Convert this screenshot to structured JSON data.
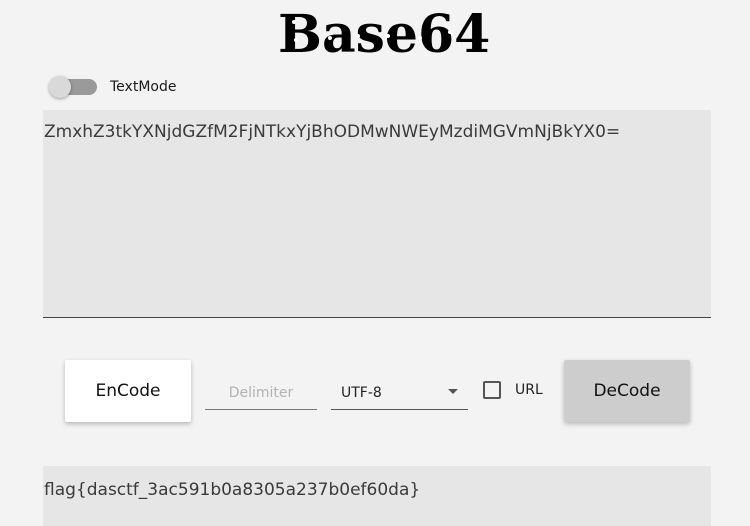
{
  "app": {
    "logo_text": "Base64"
  },
  "toggle": {
    "label": "TextMode",
    "checked": false
  },
  "input": {
    "value": "ZmxhZ3tkYXNjdGZfM2FjNTkxYjBhODMwNWEyMzdiMGVmNjBkYX0="
  },
  "toolbar": {
    "encode_label": "EnCode",
    "delimiter_placeholder": "Delimiter",
    "encoding_value": "UTF-8",
    "url_label": "URL",
    "url_checked": false,
    "decode_label": "DeCode"
  },
  "output": {
    "value": "flag{dasctf_3ac591b0a8305a237b0ef60da}"
  },
  "colors": {
    "background": "#f3f3f3",
    "field": "#e6e6e6",
    "decode_button": "#cdcdcd",
    "encode_button": "#ffffff"
  }
}
